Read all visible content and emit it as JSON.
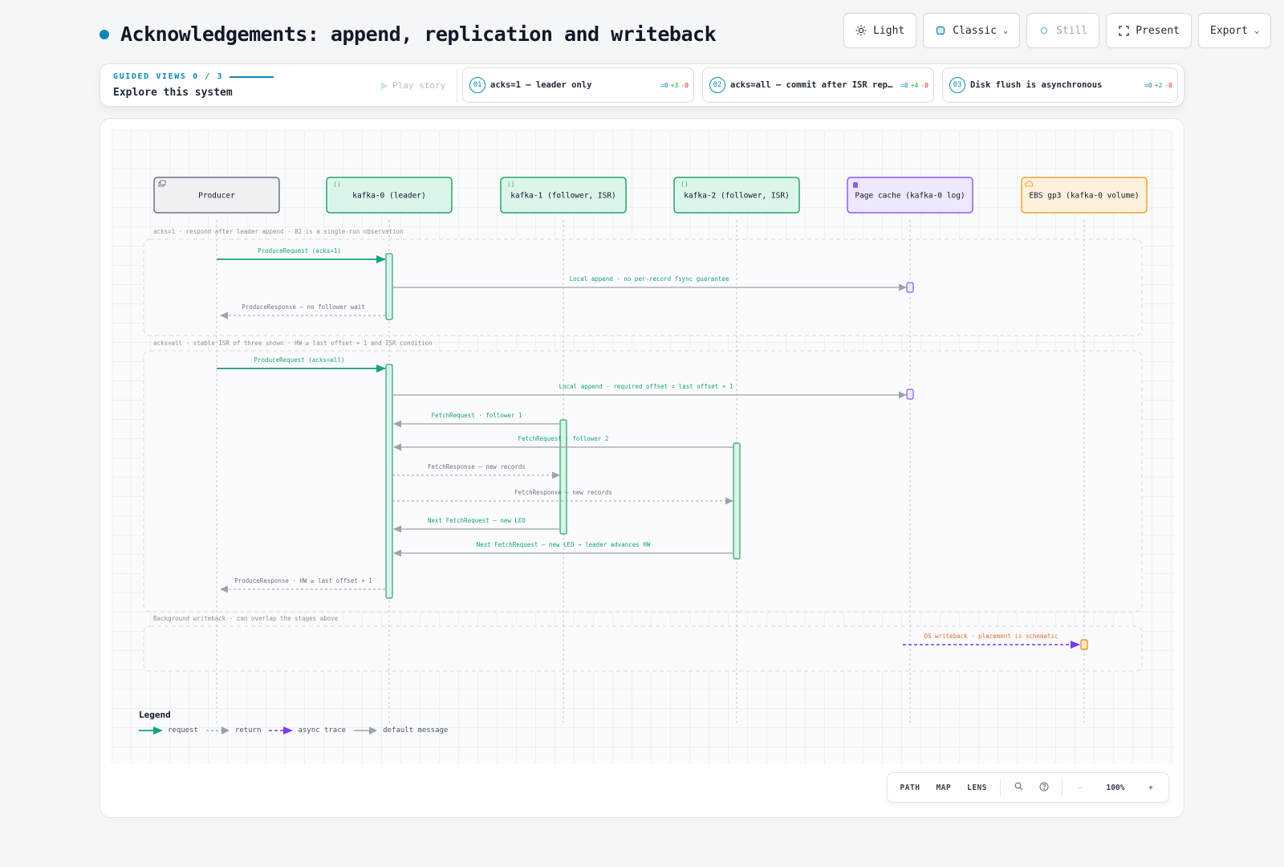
{
  "page": {
    "title": "Acknowledgements: append, replication and writeback",
    "accent": "#0e87b5"
  },
  "toolbar": {
    "theme_label": "Light",
    "style_label": "Classic",
    "still_label": "Still",
    "present_label": "Present",
    "export_label": "Export"
  },
  "guided": {
    "label": "GUIDED VIEWS 0 / 3",
    "subtitle": "Explore this system",
    "play_label": "Play story",
    "steps": [
      {
        "num": "01",
        "label": "acks=1 — leader only",
        "eq": "=0",
        "plus": "+3",
        "minus": "-0"
      },
      {
        "num": "02",
        "label": "acks=all — commit after ISR replic…",
        "eq": "=0",
        "plus": "+4",
        "minus": "-0"
      },
      {
        "num": "03",
        "label": "Disk flush is asynchronous",
        "eq": "=0",
        "plus": "+2",
        "minus": "-0"
      }
    ]
  },
  "participants": [
    {
      "name": "Producer",
      "icon": "client-icon",
      "fill": "#eef0f3",
      "stroke": "#6b7280"
    },
    {
      "name": "kafka-0 (leader)",
      "icon": "service-icon",
      "fill": "#dcf5ea",
      "stroke": "#2aa36b"
    },
    {
      "name": "kafka-1 (follower, ISR)",
      "icon": "service-icon",
      "fill": "#dcf5ea",
      "stroke": "#2aa36b"
    },
    {
      "name": "kafka-2 (follower, ISR)",
      "icon": "service-icon",
      "fill": "#dcf5ea",
      "stroke": "#2aa36b"
    },
    {
      "name": "Page cache (kafka-0 log)",
      "icon": "database-icon",
      "fill": "#efe7fb",
      "stroke": "#8b5cf6"
    },
    {
      "name": "EBS gp3 (kafka-0 volume)",
      "icon": "cloud-icon",
      "fill": "#fdf1dc",
      "stroke": "#f0a23a"
    }
  ],
  "groups": [
    {
      "label": "acks=1 · respond after leader append · B2 is a single-run observation"
    },
    {
      "label": "acks=all · stable ISR of three shown · HW ≥ last offset + 1 and ISR condition"
    },
    {
      "label": "Background writeback · can overlap the stages above"
    }
  ],
  "messages": [
    {
      "from": 0,
      "to": 1,
      "label": "ProduceRequest (acks=1)",
      "kind": "request"
    },
    {
      "from": 1,
      "to": 4,
      "label": "Local append · no per-record fsync guarantee",
      "kind": "default"
    },
    {
      "from": 1,
      "to": 0,
      "label": "ProduceResponse — no follower wait",
      "kind": "return"
    },
    {
      "from": 0,
      "to": 1,
      "label": "ProduceRequest (acks=all)",
      "kind": "request"
    },
    {
      "from": 1,
      "to": 4,
      "label": "Local append · required offset = last offset + 1",
      "kind": "default"
    },
    {
      "from": 2,
      "to": 1,
      "label": "FetchRequest · follower 1",
      "kind": "default"
    },
    {
      "from": 3,
      "to": 1,
      "label": "FetchRequest · follower 2",
      "kind": "default"
    },
    {
      "from": 1,
      "to": 2,
      "label": "FetchResponse — new records",
      "kind": "return"
    },
    {
      "from": 1,
      "to": 3,
      "label": "FetchResponse — new records",
      "kind": "return"
    },
    {
      "from": 2,
      "to": 1,
      "label": "Next FetchRequest — new LEO",
      "kind": "default"
    },
    {
      "from": 3,
      "to": 1,
      "label": "Next FetchRequest — new LEO → leader advances HW",
      "kind": "default"
    },
    {
      "from": 1,
      "to": 0,
      "label": "ProduceResponse · HW ≥ last offset + 1",
      "kind": "return"
    },
    {
      "from": 4,
      "to": 5,
      "label": "OS writeback · placement is schematic",
      "kind": "async"
    }
  ],
  "legend": {
    "title": "Legend",
    "items": [
      {
        "label": "request",
        "kind": "request"
      },
      {
        "label": "return",
        "kind": "return"
      },
      {
        "label": "async trace",
        "kind": "async"
      },
      {
        "label": "default message",
        "kind": "default"
      }
    ]
  },
  "colors": {
    "request": "#16a37a",
    "return": "#9aa3ae",
    "async": "#7c3aed",
    "default": "#9aa3ae",
    "request_label": "#16a37a",
    "default_label_green": "#16a37a",
    "return_label": "#6b7280",
    "async_label": "#e0702c"
  },
  "zoombar": {
    "path_label": "PATH",
    "map_label": "MAP",
    "lens_label": "LENS",
    "zoom_label": "100%"
  }
}
